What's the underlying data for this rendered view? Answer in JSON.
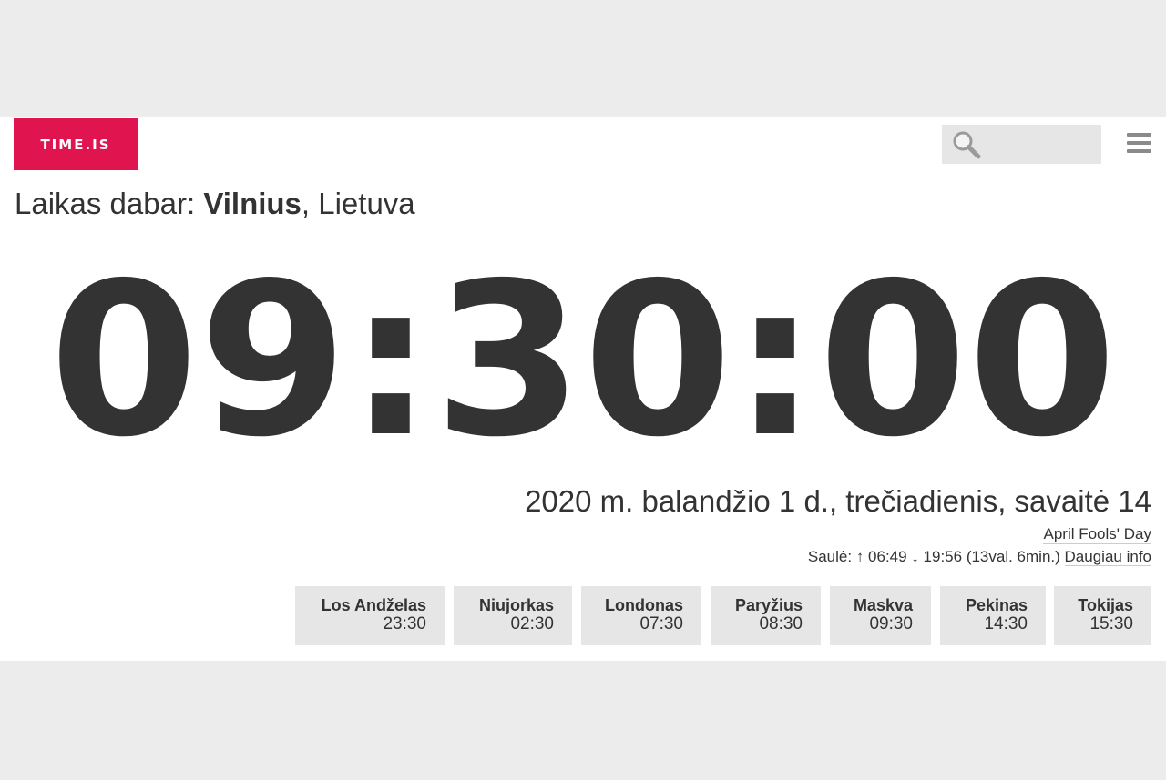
{
  "header": {
    "logo_text": "TIME.IS",
    "search_placeholder": "",
    "menu_icon": "hamburger-menu-icon",
    "search_icon": "magnifier-icon"
  },
  "location": {
    "prefix": "Laikas dabar: ",
    "city": "Vilnius",
    "country": ", Lietuva"
  },
  "clock": {
    "time": "09:30:00"
  },
  "date_info": {
    "date": "2020 m. balandžio 1 d., trečiadienis, savaitė 14",
    "holiday": "April Fools' Day",
    "sun_label": "Saulė: ",
    "sunrise": "↑ 06:49",
    "sunset": "↓ 19:56",
    "daylength": "(13val. 6min.)",
    "more_info": "Daugiau info"
  },
  "cities": [
    {
      "name": "Los Andželas",
      "time": "23:30"
    },
    {
      "name": "Niujorkas",
      "time": "02:30"
    },
    {
      "name": "Londonas",
      "time": "07:30"
    },
    {
      "name": "Paryžius",
      "time": "08:30"
    },
    {
      "name": "Maskva",
      "time": "09:30"
    },
    {
      "name": "Pekinas",
      "time": "14:30"
    },
    {
      "name": "Tokijas",
      "time": "15:30"
    }
  ],
  "colors": {
    "brand": "#e0144f",
    "text": "#333333",
    "panel": "#e6e6e6",
    "background": "#ececec"
  }
}
